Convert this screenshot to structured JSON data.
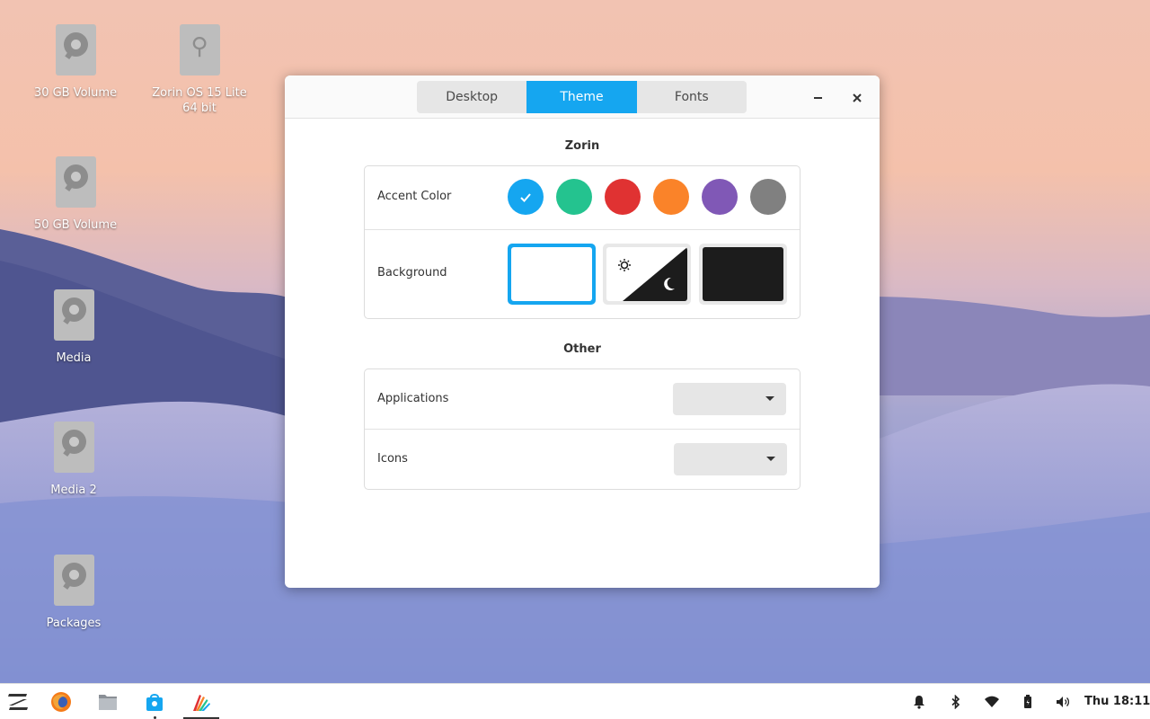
{
  "desktop": {
    "icons": [
      {
        "label": "30 GB Volume",
        "kind": "drive-icon"
      },
      {
        "label": "Zorin OS 15 Lite\n64 bit",
        "kind": "usb-drive-icon"
      },
      {
        "label": "50 GB Volume",
        "kind": "drive-icon"
      },
      {
        "label": "Media",
        "kind": "drive-icon"
      },
      {
        "label": "Media 2",
        "kind": "drive-icon"
      },
      {
        "label": "Packages",
        "kind": "drive-icon"
      }
    ]
  },
  "window": {
    "tabs": [
      "Desktop",
      "Theme",
      "Fonts"
    ],
    "active_tab": "Theme",
    "controls": {
      "minimize": "minimize-icon",
      "close": "close-icon"
    }
  },
  "zorin_section": {
    "title": "Zorin",
    "accent_label": "Accent Color",
    "accent_colors": [
      {
        "name": "blue",
        "hex": "#15a6f0",
        "selected": true
      },
      {
        "name": "green",
        "hex": "#24c38f"
      },
      {
        "name": "red",
        "hex": "#e03232"
      },
      {
        "name": "orange",
        "hex": "#fa8329"
      },
      {
        "name": "purple",
        "hex": "#8058b6"
      },
      {
        "name": "gray",
        "hex": "#808080"
      }
    ],
    "background_label": "Background",
    "background_options": [
      {
        "name": "light",
        "selected": true
      },
      {
        "name": "auto",
        "icons": [
          "sun-icon",
          "moon-icon"
        ]
      },
      {
        "name": "dark"
      }
    ]
  },
  "other_section": {
    "title": "Other",
    "applications_label": "Applications",
    "applications_value": "",
    "icons_label": "Icons",
    "icons_value": ""
  },
  "taskbar": {
    "apps": [
      "zorin-menu-icon",
      "firefox-icon",
      "files-icon",
      "software-store-icon",
      "appearance-icon"
    ],
    "tray": [
      "notifications-icon",
      "bluetooth-icon",
      "wifi-icon",
      "battery-icon",
      "volume-icon"
    ],
    "clock": "Thu 18:11"
  }
}
